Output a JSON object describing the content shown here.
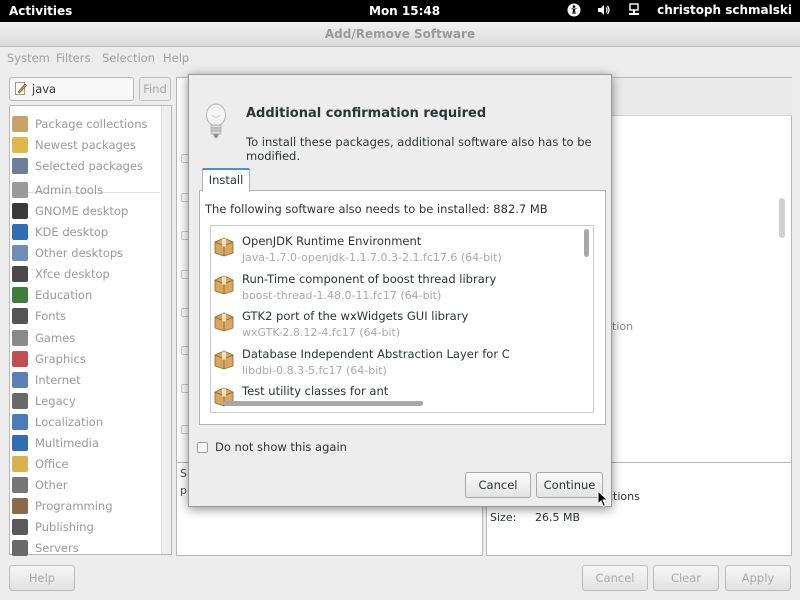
{
  "topbar": {
    "activities": "Activities",
    "clock": "Mon 15:48",
    "user": "christoph schmalski",
    "icons": [
      "accessibility-icon",
      "volume-icon",
      "network-icon"
    ]
  },
  "window": {
    "title": "Add/Remove Software",
    "menu": [
      "System",
      "Filters",
      "Selection",
      "Help"
    ]
  },
  "search": {
    "value": "java",
    "find_label": "Find"
  },
  "sidebar": {
    "items": [
      {
        "label": "Package collections",
        "icon": "package-collections-icon",
        "color": "#c8a26a"
      },
      {
        "label": "Newest packages",
        "icon": "star-icon",
        "color": "#e0b84a"
      },
      {
        "label": "Selected packages",
        "icon": "magnifier-icon",
        "color": "#6b7f96"
      },
      {
        "label": "Admin tools",
        "icon": "admin-tools-icon",
        "color": "#9a9a9a"
      },
      {
        "label": "GNOME desktop",
        "icon": "gnome-foot-icon",
        "color": "#3a3a3a"
      },
      {
        "label": "KDE desktop",
        "icon": "kde-icon",
        "color": "#2f6db5"
      },
      {
        "label": "Other desktops",
        "icon": "desktop-icon",
        "color": "#6f8db7"
      },
      {
        "label": "Xfce desktop",
        "icon": "xfce-mouse-icon",
        "color": "#4a4a4a"
      },
      {
        "label": "Education",
        "icon": "education-icon",
        "color": "#3c7f3c"
      },
      {
        "label": "Fonts",
        "icon": "fonts-icon",
        "color": "#555555"
      },
      {
        "label": "Games",
        "icon": "games-icon",
        "color": "#8a8a8a"
      },
      {
        "label": "Graphics",
        "icon": "graphics-icon",
        "color": "#c0504d"
      },
      {
        "label": "Internet",
        "icon": "globe-icon",
        "color": "#5c7fb8"
      },
      {
        "label": "Legacy",
        "icon": "legacy-icon",
        "color": "#6a6a6a"
      },
      {
        "label": "Localization",
        "icon": "flag-icon",
        "color": "#4a7db8"
      },
      {
        "label": "Multimedia",
        "icon": "multimedia-icon",
        "color": "#2f6db5"
      },
      {
        "label": "Office",
        "icon": "office-icon",
        "color": "#d8b24a"
      },
      {
        "label": "Other",
        "icon": "other-icon",
        "color": "#777777"
      },
      {
        "label": "Programming",
        "icon": "programming-icon",
        "color": "#8a6a4a"
      },
      {
        "label": "Publishing",
        "icon": "publishing-icon",
        "color": "#5a5a5a"
      },
      {
        "label": "Servers",
        "icon": "servers-icon",
        "color": "#6a6a6a"
      }
    ]
  },
  "details": {
    "partial_desc": "S",
    "partial_desc2": "p",
    "right_frag": "tion",
    "category_frag": "ctions",
    "size_label": "Size:",
    "size_value": "26.5 MB"
  },
  "bottom": {
    "help": "Help",
    "cancel": "Cancel",
    "clear": "Clear",
    "apply": "Apply"
  },
  "dialog": {
    "title": "Additional confirmation required",
    "message": "To install these packages, additional software also has to be modified.",
    "tab": "Install",
    "summary": "The following software also needs to be installed: 882.7 MB",
    "items": [
      {
        "name": "OpenJDK Runtime Environment",
        "version": "java-1.7.0-openjdk-1.1.7.0.3-2.1.fc17.6 (64-bit)"
      },
      {
        "name": "Run-Time component of boost thread library",
        "version": "boost-thread-1.48.0-11.fc17 (64-bit)"
      },
      {
        "name": "GTK2 port of the wxWidgets GUI library",
        "version": "wxGTK-2.8.12-4.fc17 (64-bit)"
      },
      {
        "name": "Database Independent Abstraction Layer for C",
        "version": "libdbi-0.8.3-5.fc17 (64-bit)"
      },
      {
        "name": "Test utility classes for ant",
        "version": ""
      }
    ],
    "dont_show": "Do not show this again",
    "cancel": "Cancel",
    "continue": "Continue"
  }
}
